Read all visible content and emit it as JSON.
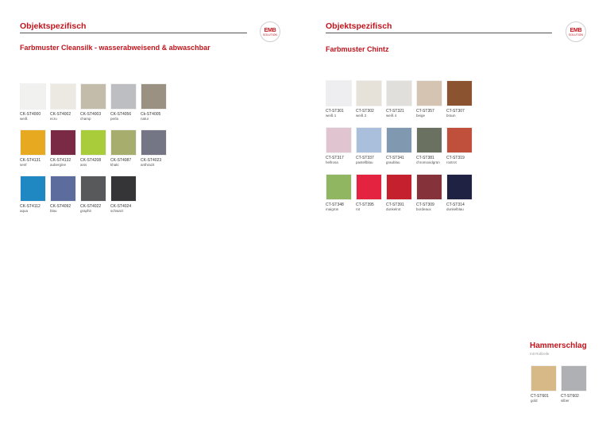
{
  "left": {
    "header": "Objektspezifisch",
    "subtitle": "Farbmuster Cleansilk - wasserabweisend & abwaschbar",
    "logo": {
      "main": "EMB",
      "sub": "SOLUTION"
    },
    "swatches": [
      {
        "code": "CK-ST4000",
        "name": "weiß",
        "color": "#f1f1ef"
      },
      {
        "code": "CK-ST4002",
        "name": "ecru",
        "color": "#ece9e2"
      },
      {
        "code": "CK-ST4003",
        "name": "champ",
        "color": "#c4bcab"
      },
      {
        "code": "CK-ST4056",
        "name": "perla",
        "color": "#bdbec1"
      },
      {
        "code": "Ck-ST4005",
        "name": "natur",
        "color": "#9b9183"
      },
      {
        "code": "CK-ST4131",
        "name": "senf",
        "color": "#e6a91f"
      },
      {
        "code": "CK-ST4132",
        "name": "aubergine",
        "color": "#7a2a44"
      },
      {
        "code": "CK-ST4208",
        "name": "anis",
        "color": "#a9cc3b"
      },
      {
        "code": "CK-ST4087",
        "name": "khaki",
        "color": "#a7ad6c"
      },
      {
        "code": "CK-ST4023",
        "name": "anthrazit",
        "color": "#747585"
      },
      {
        "code": "CK-ST4112",
        "name": "aqua",
        "color": "#1f87c1"
      },
      {
        "code": "CK-ST4092",
        "name": "blau",
        "color": "#5c6c9c"
      },
      {
        "code": "CK-ST4022",
        "name": "graphit",
        "color": "#58595b"
      },
      {
        "code": "CK-ST4024",
        "name": "schwarz",
        "color": "#353537"
      }
    ]
  },
  "right": {
    "header": "Objektspezifisch",
    "subtitle": "Farbmuster Chintz",
    "logo": {
      "main": "EMB",
      "sub": "SOLUTION"
    },
    "swatches": [
      {
        "code": "CT-ST301",
        "name": "weiß 1",
        "color": "#eeedf0"
      },
      {
        "code": "CT-ST302",
        "name": "weiß 2",
        "color": "#e7e2d9"
      },
      {
        "code": "CT-ST321",
        "name": "weiß 4",
        "color": "#e0dfdb"
      },
      {
        "code": "CT-ST357",
        "name": "beige",
        "color": "#d6c4b3"
      },
      {
        "code": "CT-ST307",
        "name": "braun",
        "color": "#8c5330"
      },
      {
        "code": "CT-ST317",
        "name": "hellrosa",
        "color": "#e0c5d0"
      },
      {
        "code": "CT-ST337",
        "name": "pastellblau",
        "color": "#a9bfdc"
      },
      {
        "code": "CT-ST341",
        "name": "graublau",
        "color": "#8199b0"
      },
      {
        "code": "CT-ST381",
        "name": "chromoxidgrün",
        "color": "#6b7161"
      },
      {
        "code": "CT-ST319",
        "name": "rostrot",
        "color": "#c04f3c"
      },
      {
        "code": "CT-ST348",
        "name": "maigrün",
        "color": "#90b661"
      },
      {
        "code": "CT-ST395",
        "name": "rot",
        "color": "#e42340"
      },
      {
        "code": "CT-ST391",
        "name": "dunkelrot",
        "color": "#c4202e"
      },
      {
        "code": "CT-ST309",
        "name": "bordeaux",
        "color": "#86323a"
      },
      {
        "code": "CT-ST314",
        "name": "dunkelblau",
        "color": "#1f2242"
      }
    ],
    "hammerschlag": {
      "title": "Hammerschlag",
      "subtitle": "mit Rollzeile",
      "swatches": [
        {
          "code": "CT-ST601",
          "name": "gold",
          "color": "#d7b987"
        },
        {
          "code": "CT-ST602",
          "name": "silber",
          "color": "#aeb0b3"
        }
      ]
    }
  }
}
